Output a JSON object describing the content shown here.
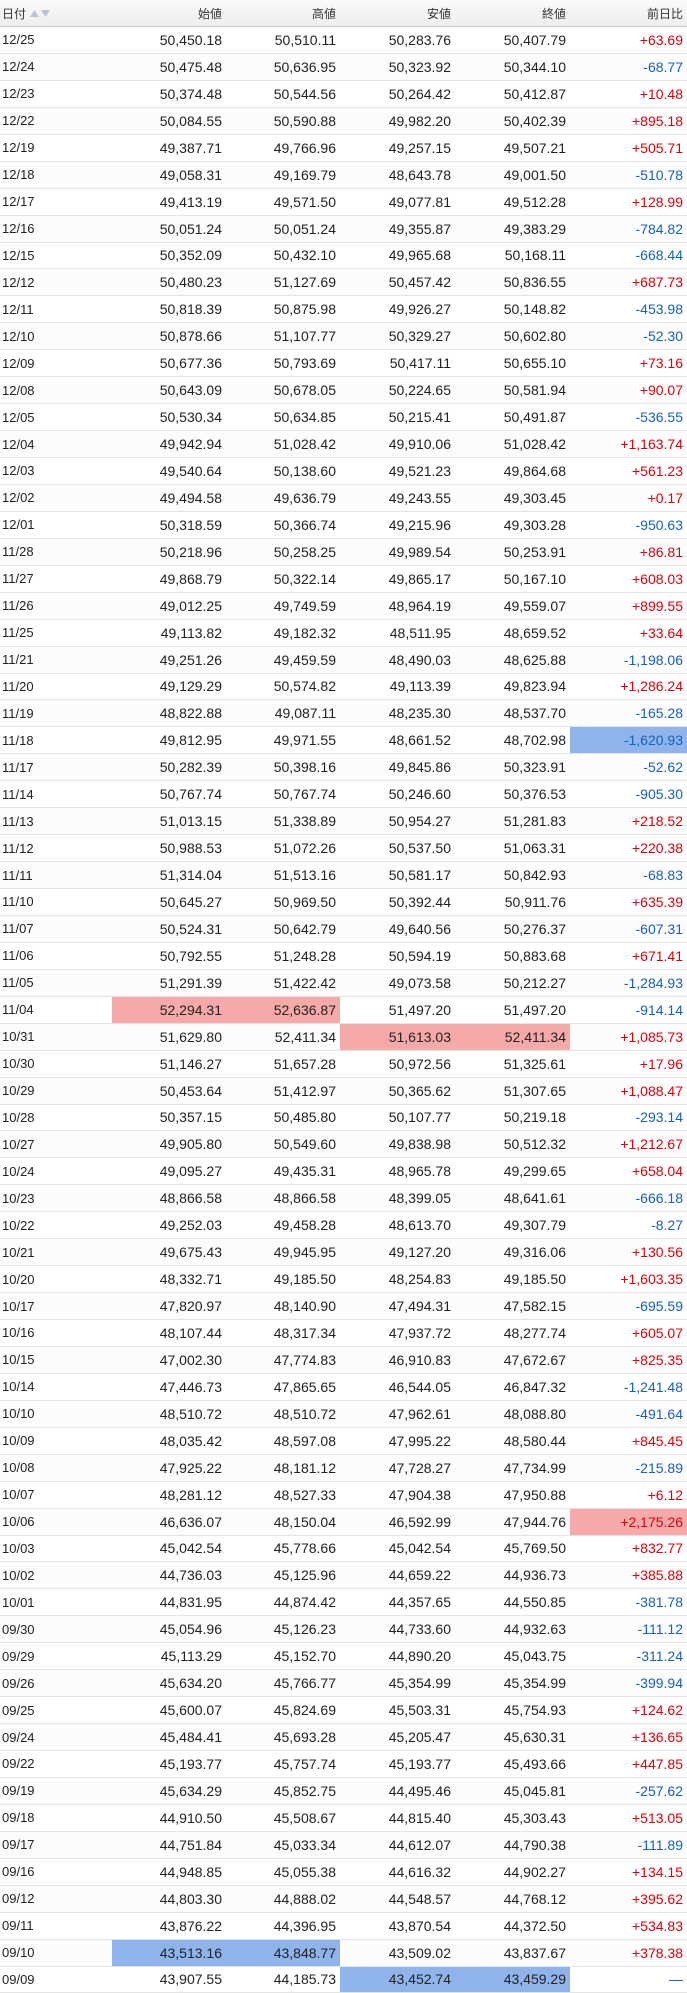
{
  "colors": {
    "positive": "#e0000a",
    "negative": "#1560c0",
    "highlight_high": "#f5a9a9",
    "highlight_low": "#8fb4ec"
  },
  "header": {
    "date": "日付",
    "open": "始値",
    "high": "高値",
    "low": "安値",
    "close": "終値",
    "change": "前日比",
    "sort_icons": [
      "triangle-up-icon",
      "triangle-down-icon"
    ]
  },
  "rows": [
    {
      "date": "12/25",
      "open": "50,450.18",
      "high": "50,510.11",
      "low": "50,283.76",
      "close": "50,407.79",
      "change": "+63.69"
    },
    {
      "date": "12/24",
      "open": "50,475.48",
      "high": "50,636.95",
      "low": "50,323.92",
      "close": "50,344.10",
      "change": "-68.77"
    },
    {
      "date": "12/23",
      "open": "50,374.48",
      "high": "50,544.56",
      "low": "50,264.42",
      "close": "50,412.87",
      "change": "+10.48"
    },
    {
      "date": "12/22",
      "open": "50,084.55",
      "high": "50,590.88",
      "low": "49,982.20",
      "close": "50,402.39",
      "change": "+895.18"
    },
    {
      "date": "12/19",
      "open": "49,387.71",
      "high": "49,766.96",
      "low": "49,257.15",
      "close": "49,507.21",
      "change": "+505.71"
    },
    {
      "date": "12/18",
      "open": "49,058.31",
      "high": "49,169.79",
      "low": "48,643.78",
      "close": "49,001.50",
      "change": "-510.78"
    },
    {
      "date": "12/17",
      "open": "49,413.19",
      "high": "49,571.50",
      "low": "49,077.81",
      "close": "49,512.28",
      "change": "+128.99"
    },
    {
      "date": "12/16",
      "open": "50,051.24",
      "high": "50,051.24",
      "low": "49,355.87",
      "close": "49,383.29",
      "change": "-784.82"
    },
    {
      "date": "12/15",
      "open": "50,352.09",
      "high": "50,432.10",
      "low": "49,965.68",
      "close": "50,168.11",
      "change": "-668.44"
    },
    {
      "date": "12/12",
      "open": "50,480.23",
      "high": "51,127.69",
      "low": "50,457.42",
      "close": "50,836.55",
      "change": "+687.73"
    },
    {
      "date": "12/11",
      "open": "50,818.39",
      "high": "50,875.98",
      "low": "49,926.27",
      "close": "50,148.82",
      "change": "-453.98"
    },
    {
      "date": "12/10",
      "open": "50,878.66",
      "high": "51,107.77",
      "low": "50,329.27",
      "close": "50,602.80",
      "change": "-52.30"
    },
    {
      "date": "12/09",
      "open": "50,677.36",
      "high": "50,793.69",
      "low": "50,417.11",
      "close": "50,655.10",
      "change": "+73.16"
    },
    {
      "date": "12/08",
      "open": "50,643.09",
      "high": "50,678.05",
      "low": "50,224.65",
      "close": "50,581.94",
      "change": "+90.07"
    },
    {
      "date": "12/05",
      "open": "50,530.34",
      "high": "50,634.85",
      "low": "50,215.41",
      "close": "50,491.87",
      "change": "-536.55"
    },
    {
      "date": "12/04",
      "open": "49,942.94",
      "high": "51,028.42",
      "low": "49,910.06",
      "close": "51,028.42",
      "change": "+1,163.74"
    },
    {
      "date": "12/03",
      "open": "49,540.64",
      "high": "50,138.60",
      "low": "49,521.23",
      "close": "49,864.68",
      "change": "+561.23"
    },
    {
      "date": "12/02",
      "open": "49,494.58",
      "high": "49,636.79",
      "low": "49,243.55",
      "close": "49,303.45",
      "change": "+0.17"
    },
    {
      "date": "12/01",
      "open": "50,318.59",
      "high": "50,366.74",
      "low": "49,215.96",
      "close": "49,303.28",
      "change": "-950.63"
    },
    {
      "date": "11/28",
      "open": "50,218.96",
      "high": "50,258.25",
      "low": "49,989.54",
      "close": "50,253.91",
      "change": "+86.81"
    },
    {
      "date": "11/27",
      "open": "49,868.79",
      "high": "50,322.14",
      "low": "49,865.17",
      "close": "50,167.10",
      "change": "+608.03"
    },
    {
      "date": "11/26",
      "open": "49,012.25",
      "high": "49,749.59",
      "low": "48,964.19",
      "close": "49,559.07",
      "change": "+899.55"
    },
    {
      "date": "11/25",
      "open": "49,113.82",
      "high": "49,182.32",
      "low": "48,511.95",
      "close": "48,659.52",
      "change": "+33.64"
    },
    {
      "date": "11/21",
      "open": "49,251.26",
      "high": "49,459.59",
      "low": "48,490.03",
      "close": "48,625.88",
      "change": "-1,198.06"
    },
    {
      "date": "11/20",
      "open": "49,129.29",
      "high": "50,574.82",
      "low": "49,113.39",
      "close": "49,823.94",
      "change": "+1,286.24"
    },
    {
      "date": "11/19",
      "open": "48,822.88",
      "high": "49,087.11",
      "low": "48,235.30",
      "close": "48,537.70",
      "change": "-165.28"
    },
    {
      "date": "11/18",
      "open": "49,812.95",
      "high": "49,971.55",
      "low": "48,661.52",
      "close": "48,702.98",
      "change": "-1,620.93",
      "hl_change": "blue"
    },
    {
      "date": "11/17",
      "open": "50,282.39",
      "high": "50,398.16",
      "low": "49,845.86",
      "close": "50,323.91",
      "change": "-52.62"
    },
    {
      "date": "11/14",
      "open": "50,767.74",
      "high": "50,767.74",
      "low": "50,246.60",
      "close": "50,376.53",
      "change": "-905.30"
    },
    {
      "date": "11/13",
      "open": "51,013.15",
      "high": "51,338.89",
      "low": "50,954.27",
      "close": "51,281.83",
      "change": "+218.52"
    },
    {
      "date": "11/12",
      "open": "50,988.53",
      "high": "51,072.26",
      "low": "50,537.50",
      "close": "51,063.31",
      "change": "+220.38"
    },
    {
      "date": "11/11",
      "open": "51,314.04",
      "high": "51,513.16",
      "low": "50,581.17",
      "close": "50,842.93",
      "change": "-68.83"
    },
    {
      "date": "11/10",
      "open": "50,645.27",
      "high": "50,969.50",
      "low": "50,392.44",
      "close": "50,911.76",
      "change": "+635.39"
    },
    {
      "date": "11/07",
      "open": "50,524.31",
      "high": "50,642.79",
      "low": "49,640.56",
      "close": "50,276.37",
      "change": "-607.31"
    },
    {
      "date": "11/06",
      "open": "50,792.55",
      "high": "51,248.28",
      "low": "50,594.19",
      "close": "50,883.68",
      "change": "+671.41"
    },
    {
      "date": "11/05",
      "open": "51,291.39",
      "high": "51,422.42",
      "low": "49,073.58",
      "close": "50,212.27",
      "change": "-1,284.93"
    },
    {
      "date": "11/04",
      "open": "52,294.31",
      "high": "52,636.87",
      "low": "51,497.20",
      "close": "51,497.20",
      "change": "-914.14",
      "hl_open": "red",
      "hl_high": "red"
    },
    {
      "date": "10/31",
      "open": "51,629.80",
      "high": "52,411.34",
      "low": "51,613.03",
      "close": "52,411.34",
      "change": "+1,085.73",
      "hl_low": "red",
      "hl_close": "red"
    },
    {
      "date": "10/30",
      "open": "51,146.27",
      "high": "51,657.28",
      "low": "50,972.56",
      "close": "51,325.61",
      "change": "+17.96"
    },
    {
      "date": "10/29",
      "open": "50,453.64",
      "high": "51,412.97",
      "low": "50,365.62",
      "close": "51,307.65",
      "change": "+1,088.47"
    },
    {
      "date": "10/28",
      "open": "50,357.15",
      "high": "50,485.80",
      "low": "50,107.77",
      "close": "50,219.18",
      "change": "-293.14"
    },
    {
      "date": "10/27",
      "open": "49,905.80",
      "high": "50,549.60",
      "low": "49,838.98",
      "close": "50,512.32",
      "change": "+1,212.67"
    },
    {
      "date": "10/24",
      "open": "49,095.27",
      "high": "49,435.31",
      "low": "48,965.78",
      "close": "49,299.65",
      "change": "+658.04"
    },
    {
      "date": "10/23",
      "open": "48,866.58",
      "high": "48,866.58",
      "low": "48,399.05",
      "close": "48,641.61",
      "change": "-666.18"
    },
    {
      "date": "10/22",
      "open": "49,252.03",
      "high": "49,458.28",
      "low": "48,613.70",
      "close": "49,307.79",
      "change": "-8.27"
    },
    {
      "date": "10/21",
      "open": "49,675.43",
      "high": "49,945.95",
      "low": "49,127.20",
      "close": "49,316.06",
      "change": "+130.56"
    },
    {
      "date": "10/20",
      "open": "48,332.71",
      "high": "49,185.50",
      "low": "48,254.83",
      "close": "49,185.50",
      "change": "+1,603.35"
    },
    {
      "date": "10/17",
      "open": "47,820.97",
      "high": "48,140.90",
      "low": "47,494.31",
      "close": "47,582.15",
      "change": "-695.59"
    },
    {
      "date": "10/16",
      "open": "48,107.44",
      "high": "48,317.34",
      "low": "47,937.72",
      "close": "48,277.74",
      "change": "+605.07"
    },
    {
      "date": "10/15",
      "open": "47,002.30",
      "high": "47,774.83",
      "low": "46,910.83",
      "close": "47,672.67",
      "change": "+825.35"
    },
    {
      "date": "10/14",
      "open": "47,446.73",
      "high": "47,865.65",
      "low": "46,544.05",
      "close": "46,847.32",
      "change": "-1,241.48"
    },
    {
      "date": "10/10",
      "open": "48,510.72",
      "high": "48,510.72",
      "low": "47,962.61",
      "close": "48,088.80",
      "change": "-491.64"
    },
    {
      "date": "10/09",
      "open": "48,035.42",
      "high": "48,597.08",
      "low": "47,995.22",
      "close": "48,580.44",
      "change": "+845.45"
    },
    {
      "date": "10/08",
      "open": "47,925.22",
      "high": "48,181.12",
      "low": "47,728.27",
      "close": "47,734.99",
      "change": "-215.89"
    },
    {
      "date": "10/07",
      "open": "48,281.12",
      "high": "48,527.33",
      "low": "47,904.38",
      "close": "47,950.88",
      "change": "+6.12"
    },
    {
      "date": "10/06",
      "open": "46,636.07",
      "high": "48,150.04",
      "low": "46,592.99",
      "close": "47,944.76",
      "change": "+2,175.26",
      "hl_change": "red"
    },
    {
      "date": "10/03",
      "open": "45,042.54",
      "high": "45,778.66",
      "low": "45,042.54",
      "close": "45,769.50",
      "change": "+832.77"
    },
    {
      "date": "10/02",
      "open": "44,736.03",
      "high": "45,125.96",
      "low": "44,659.22",
      "close": "44,936.73",
      "change": "+385.88"
    },
    {
      "date": "10/01",
      "open": "44,831.95",
      "high": "44,874.42",
      "low": "44,357.65",
      "close": "44,550.85",
      "change": "-381.78"
    },
    {
      "date": "09/30",
      "open": "45,054.96",
      "high": "45,126.23",
      "low": "44,733.60",
      "close": "44,932.63",
      "change": "-111.12"
    },
    {
      "date": "09/29",
      "open": "45,113.29",
      "high": "45,152.70",
      "low": "44,890.20",
      "close": "45,043.75",
      "change": "-311.24"
    },
    {
      "date": "09/26",
      "open": "45,634.20",
      "high": "45,766.77",
      "low": "45,354.99",
      "close": "45,354.99",
      "change": "-399.94"
    },
    {
      "date": "09/25",
      "open": "45,600.07",
      "high": "45,824.69",
      "low": "45,503.31",
      "close": "45,754.93",
      "change": "+124.62"
    },
    {
      "date": "09/24",
      "open": "45,484.41",
      "high": "45,693.28",
      "low": "45,205.47",
      "close": "45,630.31",
      "change": "+136.65"
    },
    {
      "date": "09/22",
      "open": "45,193.77",
      "high": "45,757.74",
      "low": "45,193.77",
      "close": "45,493.66",
      "change": "+447.85"
    },
    {
      "date": "09/19",
      "open": "45,634.29",
      "high": "45,852.75",
      "low": "44,495.46",
      "close": "45,045.81",
      "change": "-257.62"
    },
    {
      "date": "09/18",
      "open": "44,910.50",
      "high": "45,508.67",
      "low": "44,815.40",
      "close": "45,303.43",
      "change": "+513.05"
    },
    {
      "date": "09/17",
      "open": "44,751.84",
      "high": "45,033.34",
      "low": "44,612.07",
      "close": "44,790.38",
      "change": "-111.89"
    },
    {
      "date": "09/16",
      "open": "44,948.85",
      "high": "45,055.38",
      "low": "44,616.32",
      "close": "44,902.27",
      "change": "+134.15"
    },
    {
      "date": "09/12",
      "open": "44,803.30",
      "high": "44,888.02",
      "low": "44,548.57",
      "close": "44,768.12",
      "change": "+395.62"
    },
    {
      "date": "09/11",
      "open": "43,876.22",
      "high": "44,396.95",
      "low": "43,870.54",
      "close": "44,372.50",
      "change": "+534.83"
    },
    {
      "date": "09/10",
      "open": "43,513.16",
      "high": "43,848.77",
      "low": "43,509.02",
      "close": "43,837.67",
      "change": "+378.38",
      "hl_open": "blue",
      "hl_high": "blue"
    },
    {
      "date": "09/09",
      "open": "43,907.55",
      "high": "44,185.73",
      "low": "43,452.74",
      "close": "43,459.29",
      "change": "—",
      "hl_low": "blue",
      "hl_close": "blue"
    }
  ]
}
